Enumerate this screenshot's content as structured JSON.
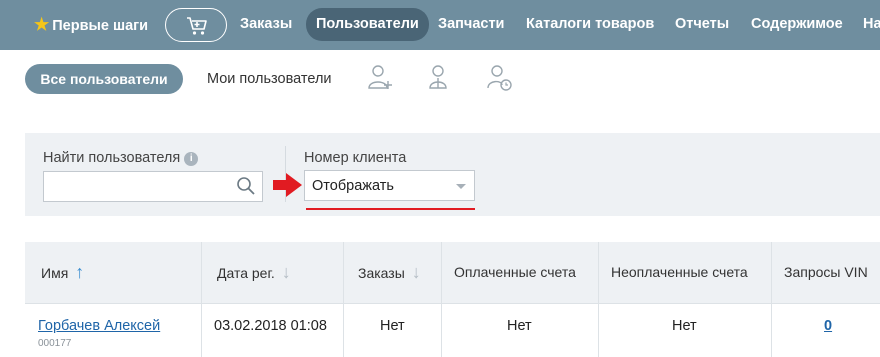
{
  "topnav": {
    "first_steps": "Первые шаги",
    "items": [
      "Заказы",
      "Пользователи",
      "Запчасти",
      "Каталоги товаров",
      "Отчеты",
      "Содержимое",
      "На"
    ],
    "active_index": 1
  },
  "subnav": {
    "all_users": "Все пользователи",
    "my_users": "Мои пользователи"
  },
  "filter": {
    "search_label": "Найти пользователя",
    "search_value": "",
    "client_number_label": "Номер клиента",
    "client_number_value": "Отображать"
  },
  "table": {
    "headers": [
      "Имя",
      "Дата рег.",
      "Заказы",
      "Оплаченные счета",
      "Неоплаченные счета",
      "Запросы VIN"
    ],
    "rows": [
      {
        "name": "Горбачев Алексей",
        "id": "000177",
        "date": "03.02.2018 01:08",
        "orders": "Нет",
        "paid": "Нет",
        "unpaid": "Нет",
        "vin": "0"
      }
    ]
  },
  "colors": {
    "nav_bg": "#6f8e9f",
    "nav_active": "#4a6576",
    "accent_red": "#e11b22",
    "link": "#1f65a8",
    "panel_bg": "#eef1f4"
  }
}
